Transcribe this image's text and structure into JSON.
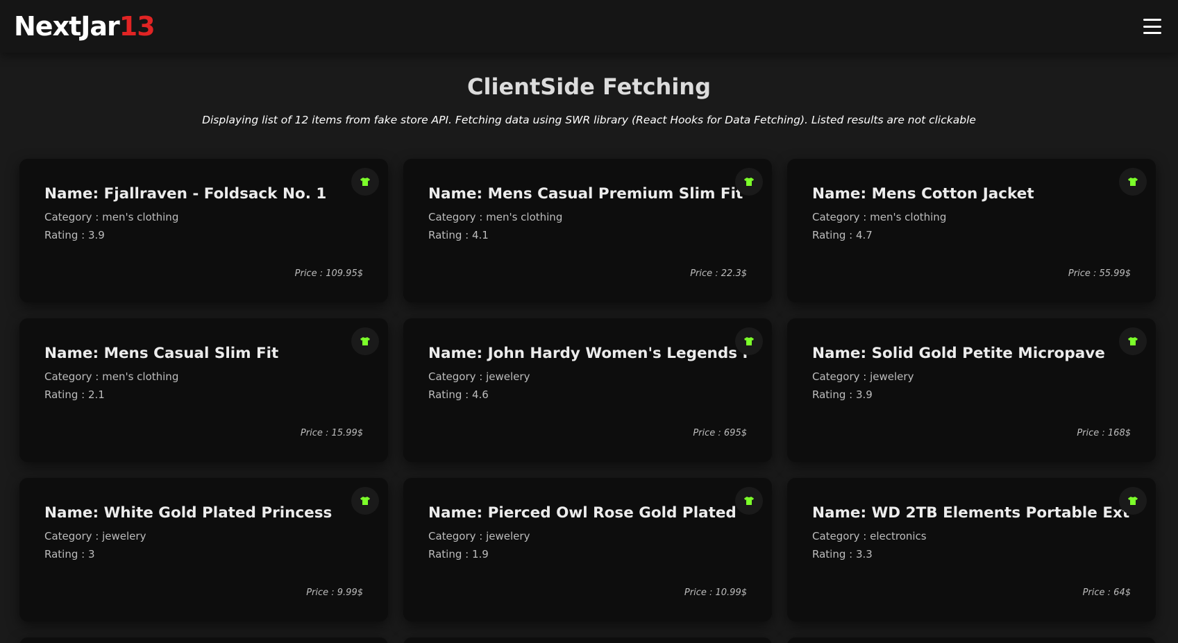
{
  "brand": {
    "text": "NextJar",
    "accent": "13"
  },
  "page": {
    "title": "ClientSide Fetching",
    "description": "Displaying list of 12 items from fake store API. Fetching data using SWR library (React Hooks for Data Fetching). Listed results are not clickable"
  },
  "icons": {
    "menu": "hamburger-menu-icon",
    "card_badge": "shirt-icon"
  },
  "colors": {
    "accent_red": "#e02424",
    "badge_green": "#7cff2a"
  },
  "products": [
    {
      "name": "Name: Fjallraven - Foldsack No. 1",
      "category": "Category : men's clothing",
      "rating": "Rating : 3.9",
      "price": "Price : 109.95$"
    },
    {
      "name": "Name: Mens Casual Premium Slim Fit",
      "category": "Category : men's clothing",
      "rating": "Rating : 4.1",
      "price": "Price : 22.3$"
    },
    {
      "name": "Name: Mens Cotton Jacket",
      "category": "Category : men's clothing",
      "rating": "Rating : 4.7",
      "price": "Price : 55.99$"
    },
    {
      "name": "Name: Mens Casual Slim Fit",
      "category": "Category : men's clothing",
      "rating": "Rating : 2.1",
      "price": "Price : 15.99$"
    },
    {
      "name": "Name: John Hardy Women's Legends N",
      "category": "Category : jewelery",
      "rating": "Rating : 4.6",
      "price": "Price : 695$"
    },
    {
      "name": "Name: Solid Gold Petite Micropave",
      "category": "Category : jewelery",
      "rating": "Rating : 3.9",
      "price": "Price : 168$"
    },
    {
      "name": "Name: White Gold Plated Princess",
      "category": "Category : jewelery",
      "rating": "Rating : 3",
      "price": "Price : 9.99$"
    },
    {
      "name": "Name: Pierced Owl Rose Gold Plated",
      "category": "Category : jewelery",
      "rating": "Rating : 1.9",
      "price": "Price : 10.99$"
    },
    {
      "name": "Name: WD 2TB Elements Portable Ext",
      "category": "Category : electronics",
      "rating": "Rating : 3.3",
      "price": "Price : 64$"
    }
  ]
}
